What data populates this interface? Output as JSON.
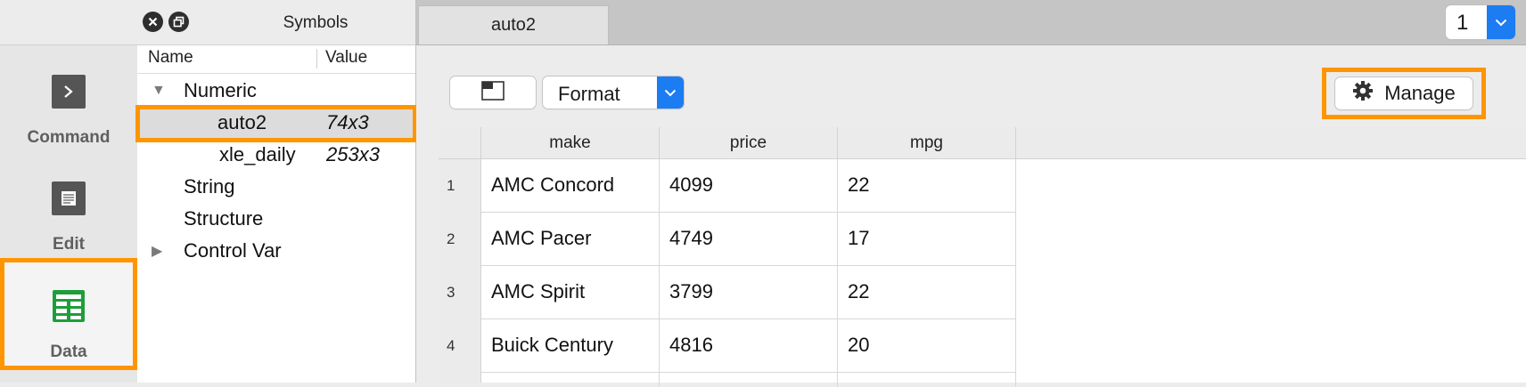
{
  "modes": [
    {
      "label": "Command",
      "icon": "terminal-icon"
    },
    {
      "label": "Edit",
      "icon": "document-icon"
    },
    {
      "label": "Data",
      "icon": "spreadsheet-icon"
    }
  ],
  "symbols": {
    "title": "Symbols",
    "columns": {
      "name": "Name",
      "value": "Value"
    },
    "tree": {
      "numeric": "Numeric",
      "auto2_name": "auto2",
      "auto2_value": "74x3",
      "xle_name": "xle_daily",
      "xle_value": "253x3",
      "string": "String",
      "structure": "Structure",
      "control_var": "Control Var"
    }
  },
  "main": {
    "tab_label": "auto2",
    "page_selector": "1",
    "format_label": "Format",
    "manage_label": "Manage"
  },
  "grid": {
    "columns": [
      "make",
      "price",
      "mpg"
    ],
    "rows": [
      {
        "n": "1",
        "make": "AMC Concord",
        "price": "4099",
        "mpg": "22"
      },
      {
        "n": "2",
        "make": "AMC Pacer",
        "price": "4749",
        "mpg": "17"
      },
      {
        "n": "3",
        "make": "AMC Spirit",
        "price": "3799",
        "mpg": "22"
      },
      {
        "n": "4",
        "make": "Buick Century",
        "price": "4816",
        "mpg": "20"
      }
    ]
  },
  "colors": {
    "highlight": "#ff9500",
    "accent": "#1c7cf2",
    "data_icon": "#1e9e3a"
  }
}
